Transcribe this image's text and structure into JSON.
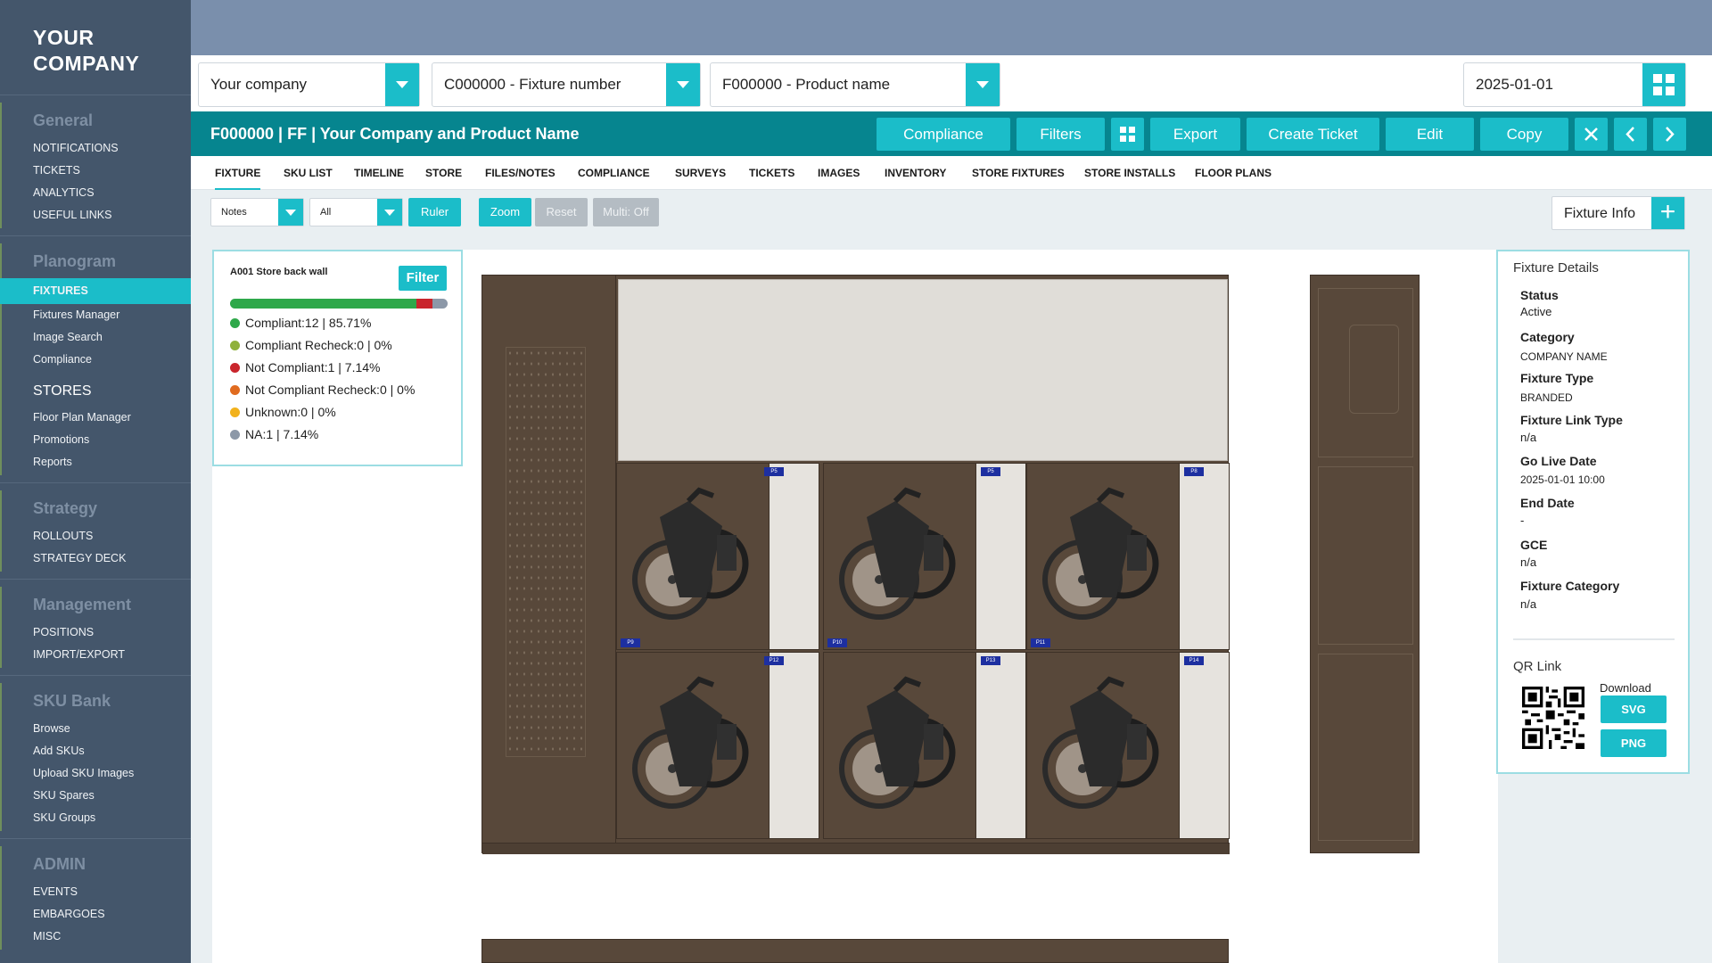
{
  "sidebar": {
    "logo_line1": "YOUR",
    "logo_line2": "COMPANY",
    "sections": {
      "general": {
        "title": "General",
        "items": [
          "NOTIFICATIONS",
          "TICKETS",
          "ANALYTICS",
          "USEFUL LINKS"
        ]
      },
      "planogram": {
        "title": "Planogram",
        "active": "FIXTURES",
        "items": [
          "Fixtures Manager",
          "Image Search",
          "Compliance"
        ],
        "stores_title": "STORES",
        "stores_items": [
          "Floor Plan Manager",
          "Promotions",
          "Reports"
        ]
      },
      "strategy": {
        "title": "Strategy",
        "items": [
          "ROLLOUTS",
          "STRATEGY DECK"
        ]
      },
      "management": {
        "title": "Management",
        "items": [
          "POSITIONS",
          "IMPORT/EXPORT"
        ]
      },
      "skubank": {
        "title": "SKU Bank",
        "items": [
          "Browse",
          "Add SKUs",
          "Upload SKU Images",
          "SKU Spares",
          "SKU Groups"
        ]
      },
      "admin": {
        "title": "ADMIN",
        "items": [
          "EVENTS",
          "EMBARGOES",
          "MISC"
        ]
      }
    }
  },
  "selectors": {
    "company": "Your company",
    "fixture": "C000000 - Fixture number",
    "product": "F000000 - Product name",
    "date": "2025-01-01"
  },
  "header": {
    "title": "F000000 | FF | Your Company and Product Name",
    "buttons": {
      "compliance": "Compliance",
      "filters": "Filters",
      "export": "Export",
      "create_ticket": "Create Ticket",
      "edit": "Edit",
      "copy": "Copy"
    }
  },
  "tabs": [
    "FIXTURE",
    "SKU LIST",
    "TIMELINE",
    "STORE",
    "FILES/NOTES",
    "COMPLIANCE",
    "SURVEYS",
    "TICKETS",
    "IMAGES",
    "INVENTORY",
    "STORE FIXTURES",
    "STORE INSTALLS",
    "FLOOR PLANS"
  ],
  "toolbar": {
    "notes_select": "Notes",
    "all_select": "All",
    "ruler": "Ruler",
    "zoom": "Zoom",
    "reset": "Reset",
    "multi": "Multi: Off",
    "fixture_info": "Fixture Info"
  },
  "summary": {
    "title": "A001 Store back wall",
    "filter": "Filter",
    "progress": [
      {
        "color": "#2ea84a",
        "fraction": 0.8571
      },
      {
        "color": "#c9252c",
        "fraction": 0.0714
      },
      {
        "color": "#8c98a8",
        "fraction": 0.0714
      }
    ],
    "legend": [
      {
        "label": "Compliant:12 | 85.71%",
        "color": "#2ea84a"
      },
      {
        "label": "Compliant Recheck:0 | 0%",
        "color": "#8fb13b"
      },
      {
        "label": "Not Compliant:1 | 7.14%",
        "color": "#c9252c"
      },
      {
        "label": "Not Compliant Recheck:0 | 0%",
        "color": "#e06b1f"
      },
      {
        "label": "Unknown:0 | 0%",
        "color": "#f2b21c"
      },
      {
        "label": "NA:1 | 7.14%",
        "color": "#8c98a8"
      }
    ]
  },
  "planogram": {
    "tags": [
      "P5",
      "P5",
      "P8",
      "P9",
      "P10",
      "P11",
      "P12",
      "P13",
      "P14"
    ]
  },
  "details": {
    "heading": "Fixture Details",
    "status_label": "Status",
    "status": "Active",
    "category_label": "Category",
    "category": "COMPANY NAME",
    "type_label": "Fixture Type",
    "type": "BRANDED",
    "link_type_label": "Fixture Link Type",
    "link_type": "n/a",
    "golive_label": "Go Live Date",
    "golive": "2025-01-01 10:00",
    "end_label": "End Date",
    "end": "-",
    "gce_label": "GCE",
    "gce": "n/a",
    "fcat_label": "Fixture Category",
    "fcat": "n/a",
    "qr_heading": "QR Link",
    "download": "Download",
    "svg": "SVG",
    "png": "PNG"
  }
}
